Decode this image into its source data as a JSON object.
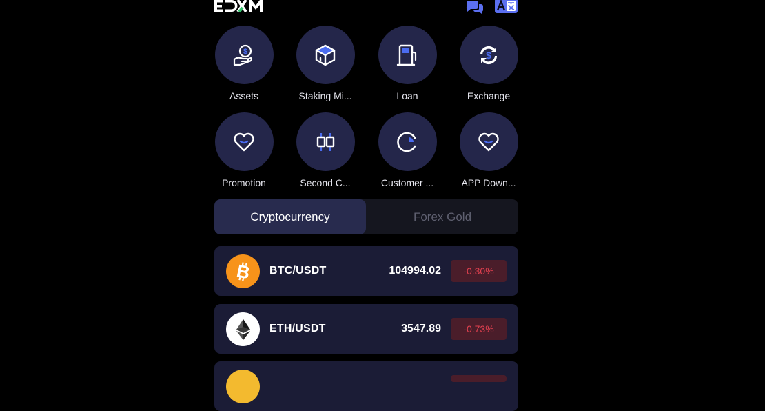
{
  "header": {
    "logo_text": "EDXM",
    "chat_icon": "chat-bubbles-icon",
    "language_icon": "language-translate-icon"
  },
  "menu": [
    {
      "label": "Assets",
      "icon": "hand-coin-icon"
    },
    {
      "label": "Staking Mi...",
      "icon": "cube-icon"
    },
    {
      "label": "Loan",
      "icon": "fuel-pump-icon"
    },
    {
      "label": "Exchange",
      "icon": "exchange-dollar-icon"
    },
    {
      "label": "Promotion",
      "icon": "heart-icon"
    },
    {
      "label": "Second C...",
      "icon": "candlestick-icon"
    },
    {
      "label": "Customer ...",
      "icon": "chat-pie-icon"
    },
    {
      "label": "APP Down...",
      "icon": "heart-icon"
    }
  ],
  "tabs": {
    "active": "Cryptocurrency",
    "inactive": "Forex Gold"
  },
  "market": [
    {
      "pair": "BTC/USDT",
      "price": "104994.02",
      "change": "-0.30%",
      "icon": "bitcoin-icon"
    },
    {
      "pair": "ETH/USDT",
      "price": "3547.89",
      "change": "-0.73%",
      "icon": "ethereum-icon"
    }
  ],
  "colors": {
    "accent": "#4b6cf0",
    "circle_bg": "#24264a",
    "row_bg": "#1b1c36",
    "negative": "#e0404f",
    "negative_bg": "#4a1d2a",
    "btc_orange": "#f7931a"
  }
}
